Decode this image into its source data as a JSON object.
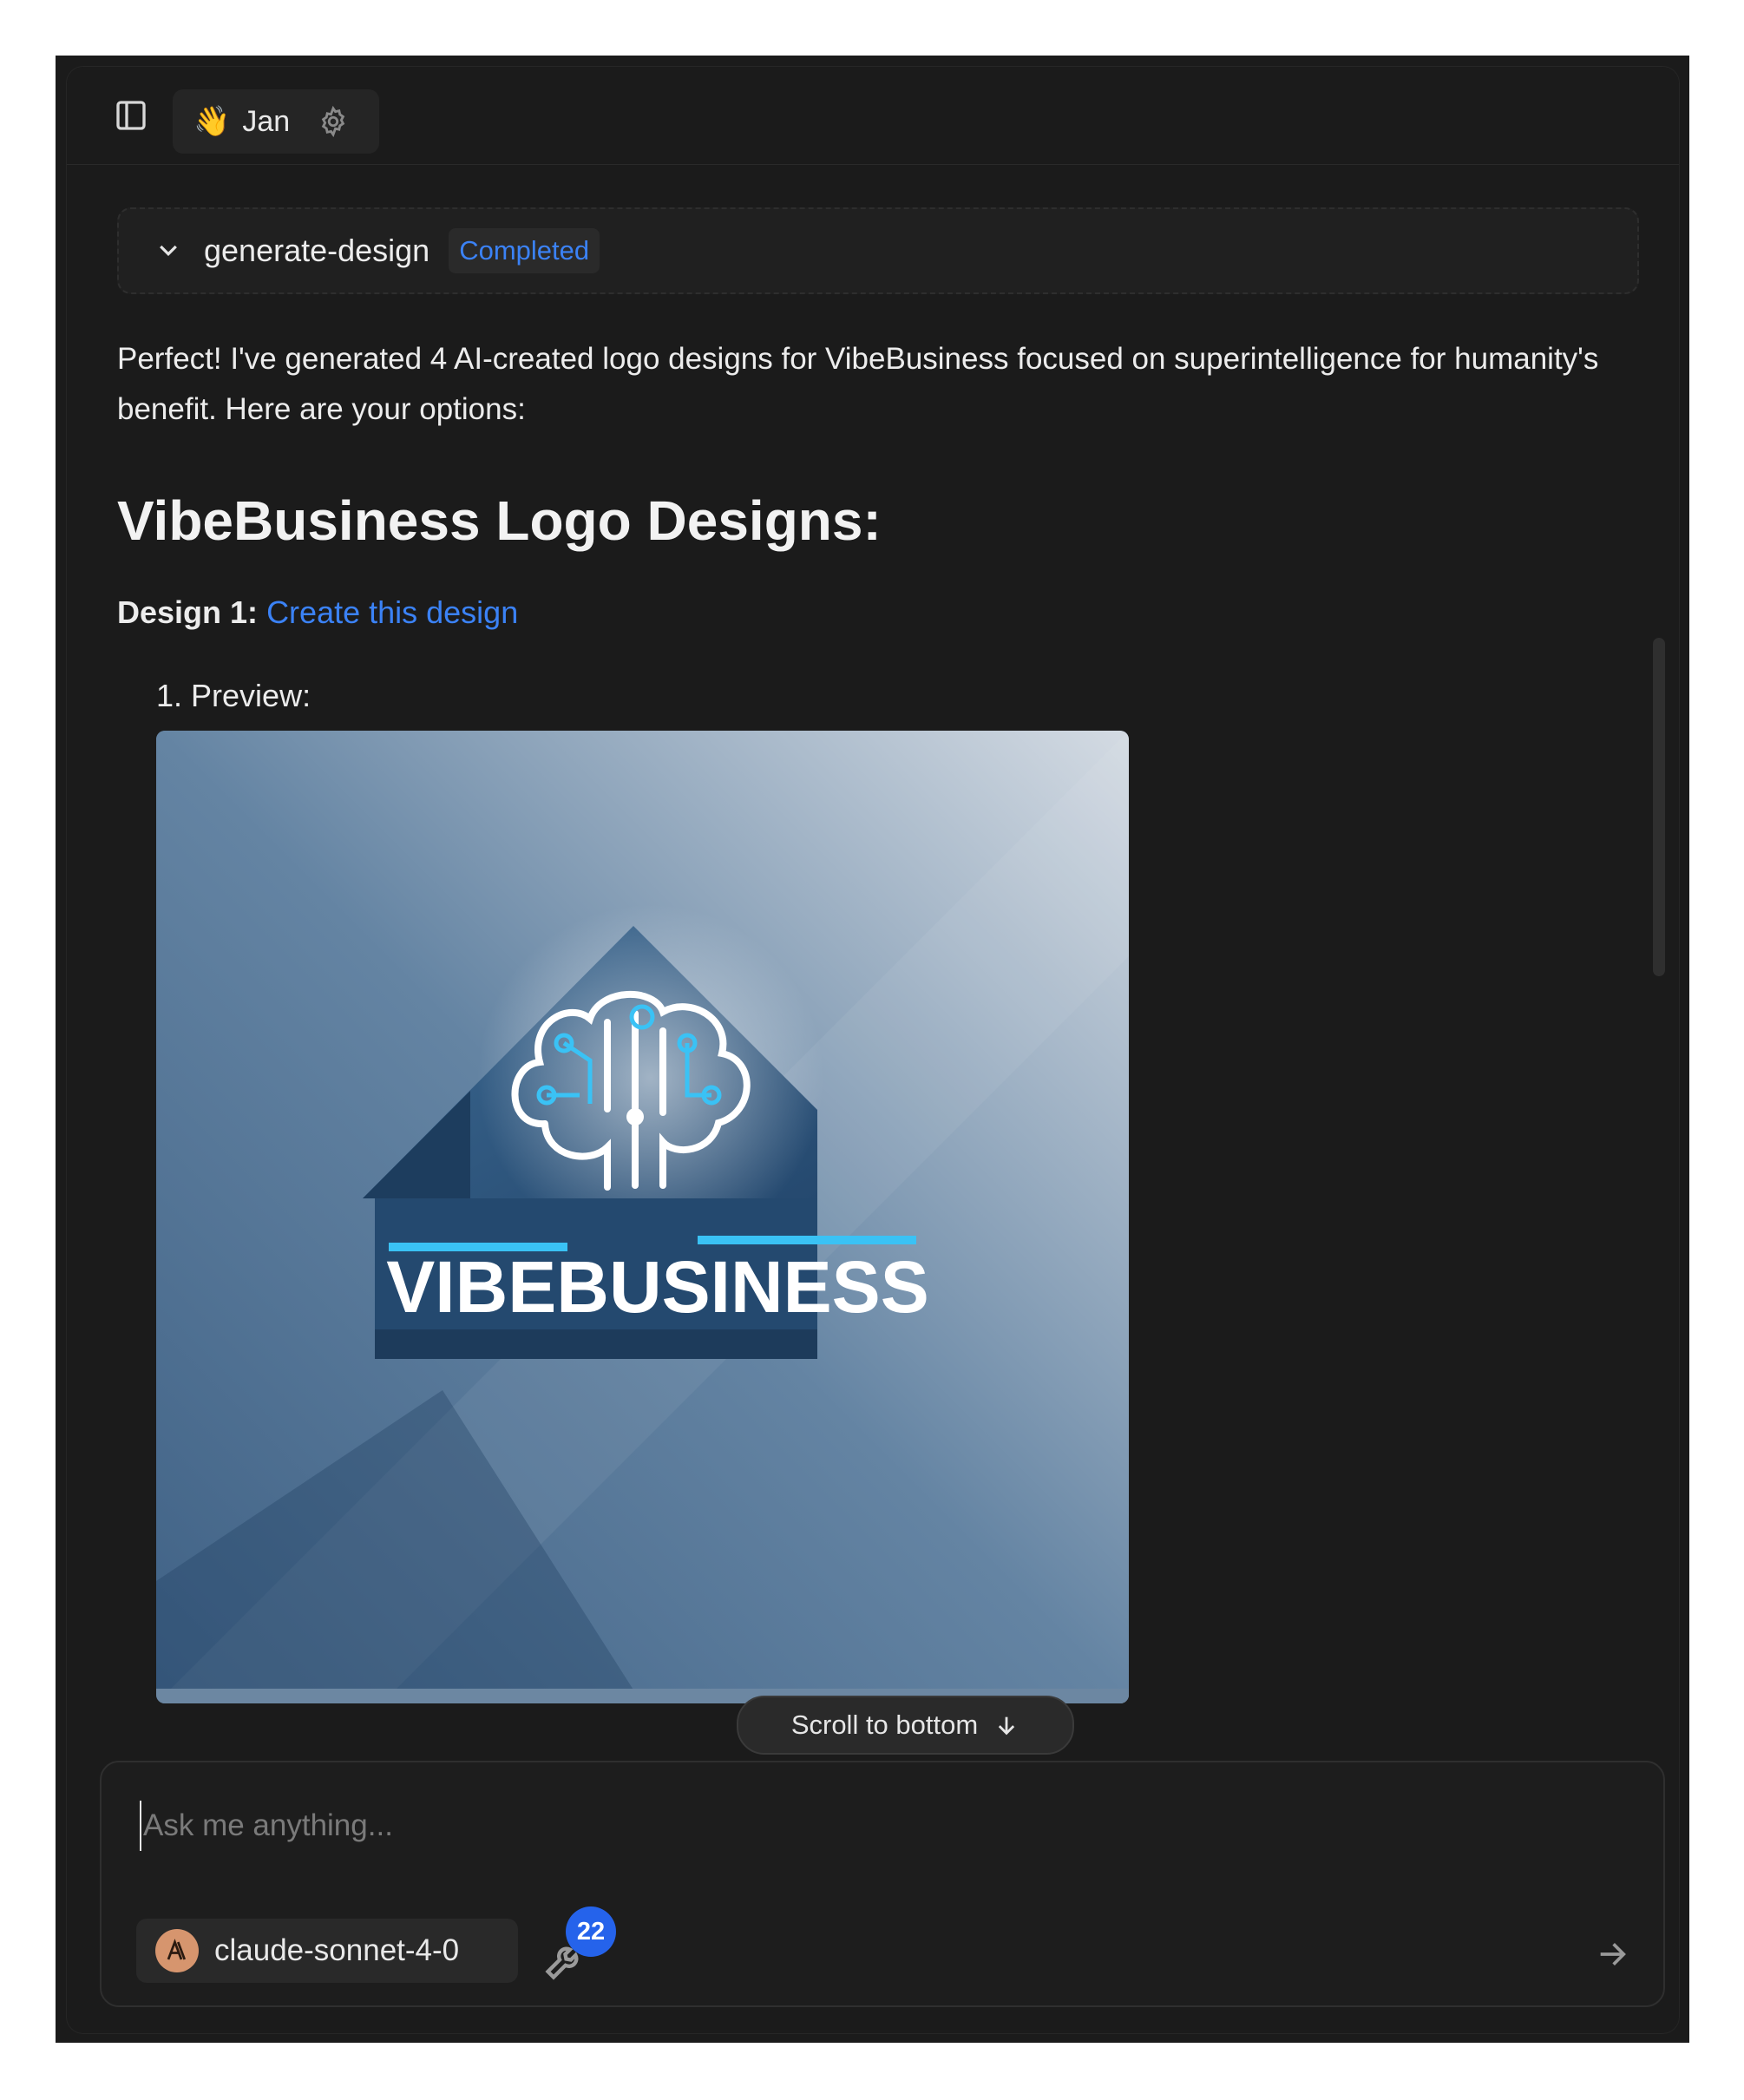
{
  "header": {
    "assistant_emoji": "👋",
    "assistant_name": "Jan"
  },
  "tool_call": {
    "name": "generate-design",
    "status": "Completed"
  },
  "message": {
    "intro": "Perfect! I've generated 4 AI-created logo designs for VibeBusiness focused on superintelligence for humanity's benefit. Here are your options:",
    "heading": "VibeBusiness Logo Designs:",
    "design_label": "Design 1:",
    "design_link": "Create this design",
    "preview_label": "1. Preview:",
    "logo_text": "VIBEBUSINESS"
  },
  "scroll_button": {
    "label": "Scroll to bottom"
  },
  "composer": {
    "placeholder": "Ask me anything...",
    "model_name": "claude-sonnet-4-0",
    "tools_count": "22"
  },
  "colors": {
    "background": "#1b1b1b",
    "accent": "#3b82f6",
    "badge": "#2563eb",
    "model_avatar": "#d6956e"
  },
  "icons": {
    "sidebar_toggle": "sidebar-toggle-icon",
    "settings": "gear-icon",
    "expand": "chevron-down-icon",
    "scroll": "arrow-down-icon",
    "tools": "wrench-icon",
    "send": "arrow-right-icon",
    "model": "anthropic-logo-icon"
  }
}
